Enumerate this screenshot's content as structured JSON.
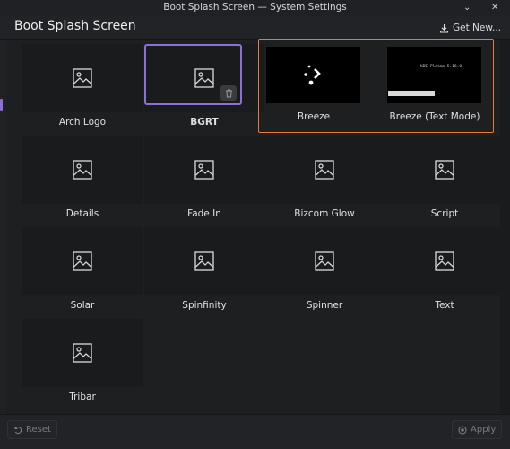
{
  "window": {
    "title": "Boot Splash Screen — System Settings"
  },
  "header": {
    "page_title": "Boot Splash Screen",
    "get_new_label": "Get New..."
  },
  "themes": [
    {
      "label": "Arch Logo",
      "selected": false,
      "preview": "placeholder"
    },
    {
      "label": "BGRT",
      "selected": true,
      "preview": "placeholder"
    },
    {
      "label": "Breeze",
      "selected": false,
      "preview": "breeze-spinner"
    },
    {
      "label": "Breeze (Text Mode)",
      "selected": false,
      "preview": "text-mode",
      "preview_text": "KDE Plasma 5.18.0"
    },
    {
      "label": "Details",
      "selected": false,
      "preview": "placeholder"
    },
    {
      "label": "Fade In",
      "selected": false,
      "preview": "placeholder"
    },
    {
      "label": "Bizcom Glow",
      "selected": false,
      "preview": "placeholder"
    },
    {
      "label": "Script",
      "selected": false,
      "preview": "placeholder"
    },
    {
      "label": "Solar",
      "selected": false,
      "preview": "placeholder"
    },
    {
      "label": "Spinfinity",
      "selected": false,
      "preview": "placeholder"
    },
    {
      "label": "Spinner",
      "selected": false,
      "preview": "placeholder"
    },
    {
      "label": "Text",
      "selected": false,
      "preview": "placeholder"
    },
    {
      "label": "Tribar",
      "selected": false,
      "preview": "placeholder"
    }
  ],
  "footer": {
    "reset_label": "Reset",
    "apply_label": "Apply"
  },
  "colors": {
    "selection": "#8e6fd8",
    "highlight": "#e87a3e"
  }
}
